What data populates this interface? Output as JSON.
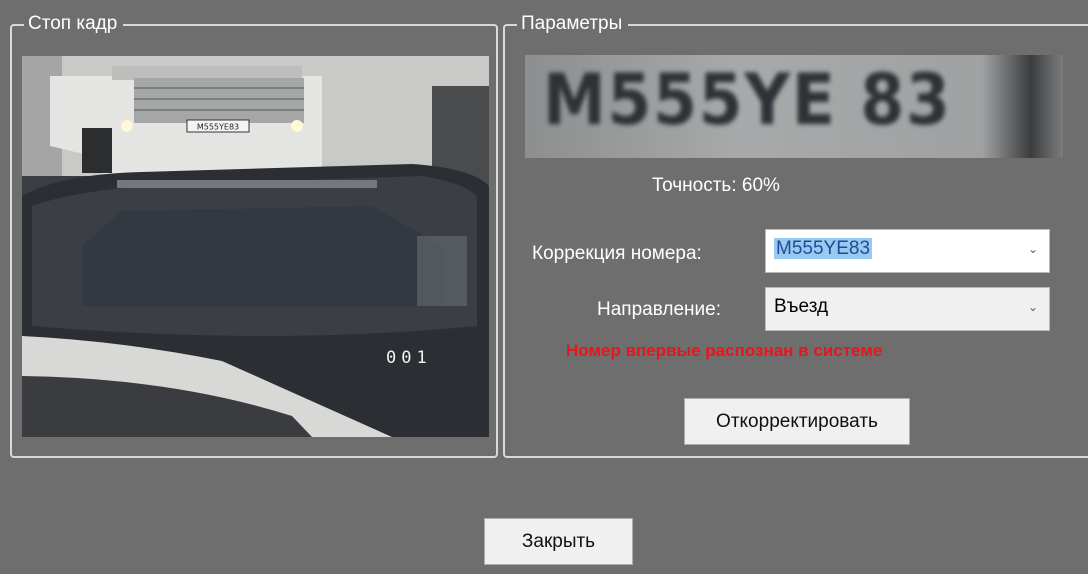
{
  "stop_frame": {
    "title": "Стоп кадр",
    "camera_overlay": "001",
    "plate_on_car": "M555YE83"
  },
  "params": {
    "title": "Параметры",
    "plate_image_text": "M555YE 83",
    "accuracy_text": "Точность: 60%",
    "correction_label": "Коррекция номера:",
    "correction_value": "M555YE83",
    "direction_label": "Направление:",
    "direction_value": "Въезд",
    "status_message": "Номер впервые распознан в системе",
    "correct_button": "Откорректировать"
  },
  "footer": {
    "close_button": "Закрыть"
  },
  "colors": {
    "background": "#6e6e6e",
    "status_error": "#e8151b",
    "selection": "#99c9ef"
  },
  "icons": {
    "dropdown": "chevron-down-icon"
  }
}
